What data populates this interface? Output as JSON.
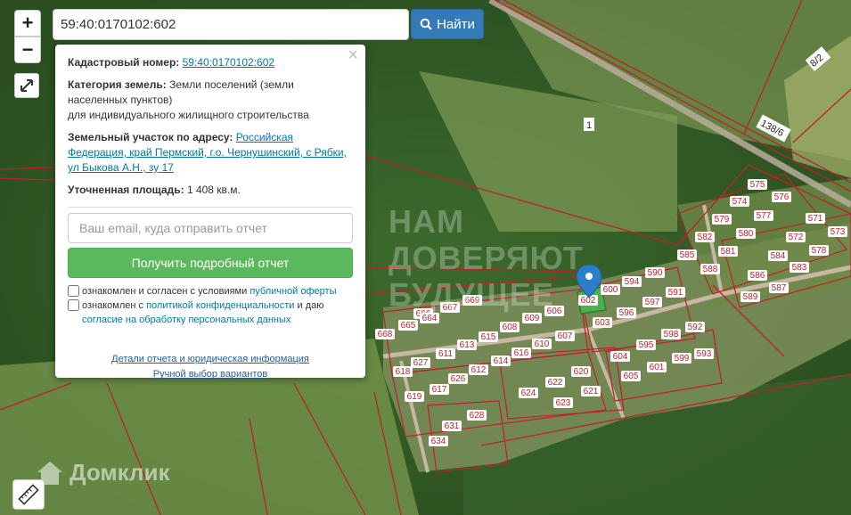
{
  "search": {
    "value": "59:40:0170102:602",
    "button_label": "Найти"
  },
  "zoom": {
    "in_label": "+",
    "out_label": "−"
  },
  "popup": {
    "cadastral_label": "Кадастровый номер:",
    "cadastral_value": "59:40:0170102:602",
    "category_label": "Категория земель:",
    "category_value": "Земли поселений (земли населенных пунктов)",
    "category_use": "для индивидуального жилищного строительства",
    "address_label": "Земельный участок по адресу:",
    "address_value": "Российская Федерация, край Пермский, г.о. Чернушинский, с Рябки, ул Быкова А.Н., зу 17",
    "area_label": "Уточненная площадь:",
    "area_value": "1 408 кв.м.",
    "email_placeholder": "Ваш email, куда отправить отчет",
    "report_button": "Получить подробный отчет",
    "consent1_text": "ознакомлен и согласен с условиями ",
    "consent1_link": "публичной оферты",
    "consent2_text": "ознакомлен с ",
    "consent2_link": "политикой конфиденциальности",
    "consent2_mid": " и даю ",
    "consent2_link2": "согласие на обработку персональных данных",
    "details_link": "Детали отчета и юридическая информация",
    "manual_link": "Ручной выбор вариантов",
    "close_glyph": "×"
  },
  "watermarks": {
    "brand": "Домклик",
    "trust": [
      "НАМ",
      "ДОВЕРЯЮТ",
      "БУДУЩЕЕ"
    ]
  },
  "map_labels": {
    "road_left": "8/2",
    "road_right": "138/6",
    "field": "1",
    "plots": [
      "575",
      "576",
      "574",
      "577",
      "571",
      "579",
      "573",
      "580",
      "582",
      "572",
      "581",
      "578",
      "585",
      "584",
      "588",
      "583",
      "586",
      "587",
      "589",
      "590",
      "594",
      "591",
      "600",
      "597",
      "596",
      "603",
      "602",
      "592",
      "598",
      "595",
      "593",
      "599",
      "604",
      "601",
      "605",
      "666",
      "667",
      "668",
      "669",
      "665",
      "664",
      "609",
      "606",
      "607",
      "608",
      "613",
      "615",
      "610",
      "616",
      "611",
      "614",
      "612",
      "617",
      "627",
      "626",
      "618",
      "619",
      "620",
      "622",
      "624",
      "621",
      "623",
      "628",
      "631",
      "634"
    ]
  },
  "colors": {
    "parcel_line": "#c0202a",
    "selected_parcel": "#4caf50",
    "marker": "#2a7fc9"
  }
}
